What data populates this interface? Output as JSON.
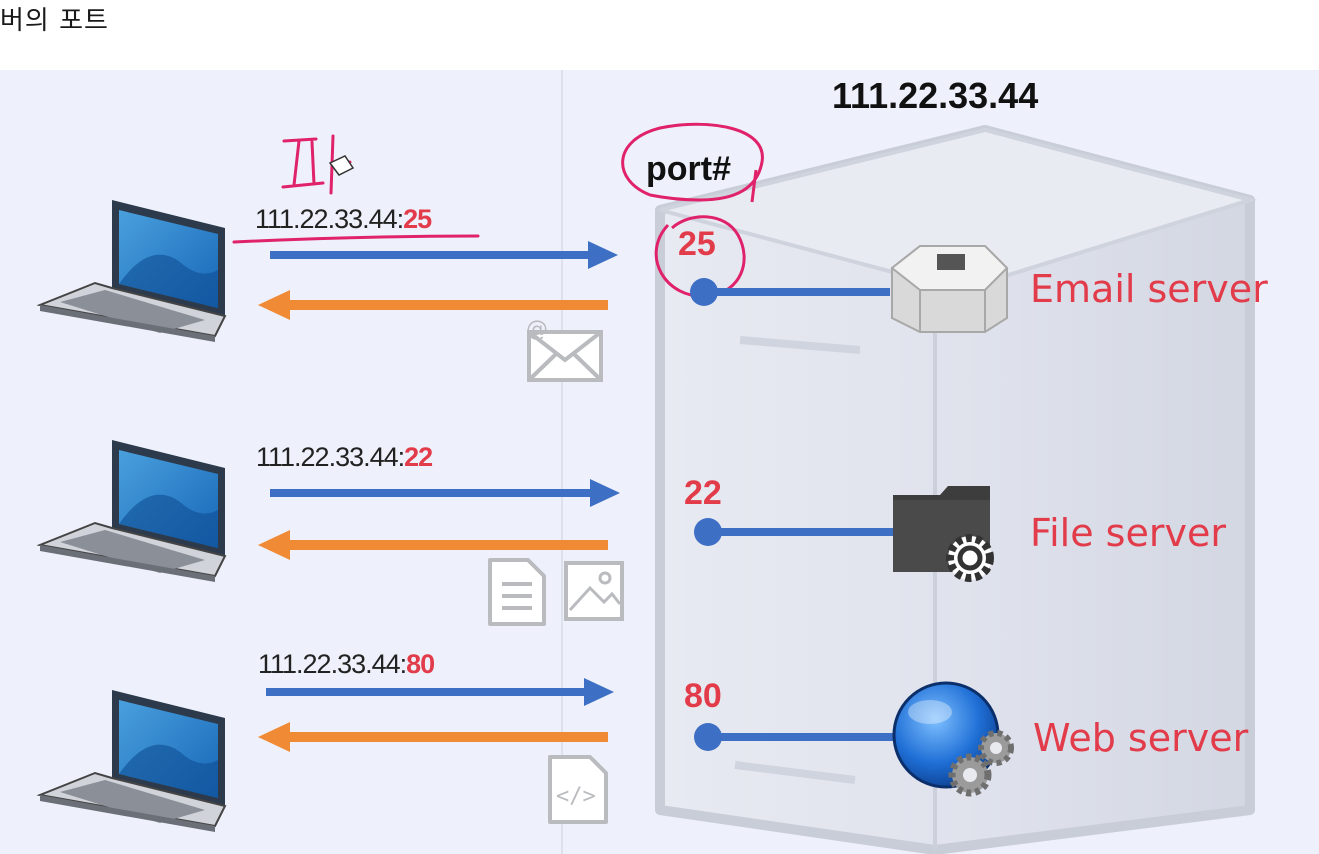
{
  "header": {
    "title": "버의 포트"
  },
  "server": {
    "ip": "111.22.33.44",
    "port_label": "port#"
  },
  "connections": [
    {
      "address": "111.22.33.44:",
      "port": "25",
      "server_label": "Email server",
      "payload_icons": [
        "email-icon"
      ]
    },
    {
      "address": "111.22.33.44:",
      "port": "22",
      "server_label": "File server",
      "payload_icons": [
        "document-icon",
        "image-icon"
      ]
    },
    {
      "address": "111.22.33.44:",
      "port": "80",
      "server_label": "Web server",
      "payload_icons": [
        "code-file-icon"
      ]
    }
  ],
  "annotations": {
    "handwritten_mark": "피",
    "ink_color": "#e0226a"
  },
  "colors": {
    "request_arrow": "#3d6fc4",
    "response_arrow": "#f08a34",
    "port_text": "#e23b4a",
    "server_text": "#e23b4a",
    "port_line": "#3d6fc4"
  }
}
